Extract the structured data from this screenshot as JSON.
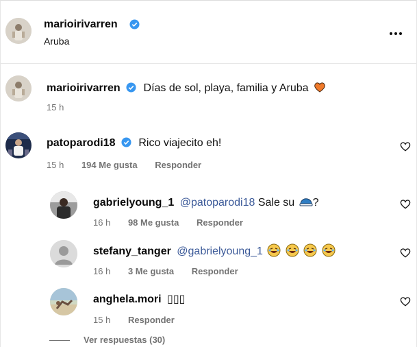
{
  "post": {
    "author": "marioirivarren",
    "location": "Aruba"
  },
  "caption": {
    "author": "marioirivarren",
    "text": "Días de sol, playa, familia y Aruba",
    "emoji": "orange-heart",
    "time": "15 h"
  },
  "comments": [
    {
      "author": "patoparodi18",
      "verified": true,
      "text": "Rico viajecito eh!",
      "time": "15 h",
      "likes": "194 Me gusta",
      "reply": "Responder"
    },
    {
      "author": "gabrielyoung_1",
      "mention": "@patoparodi18",
      "text": "Sale su",
      "suffix": "?",
      "time": "16 h",
      "likes": "98 Me gusta",
      "reply": "Responder"
    },
    {
      "author": "stefany_tanger",
      "mention": "@gabrielyoung_1",
      "time": "16 h",
      "likes": "3 Me gusta",
      "reply": "Responder"
    },
    {
      "author": "anghela.mori",
      "text": "▯▯▯",
      "time": "15 h",
      "reply": "Responder"
    }
  ],
  "view_replies": "Ver respuestas (30)",
  "colors": {
    "verified": "#3897f0",
    "mention": "#3b5998",
    "meta": "#737373",
    "heart_emoji": "#f07a2a"
  }
}
